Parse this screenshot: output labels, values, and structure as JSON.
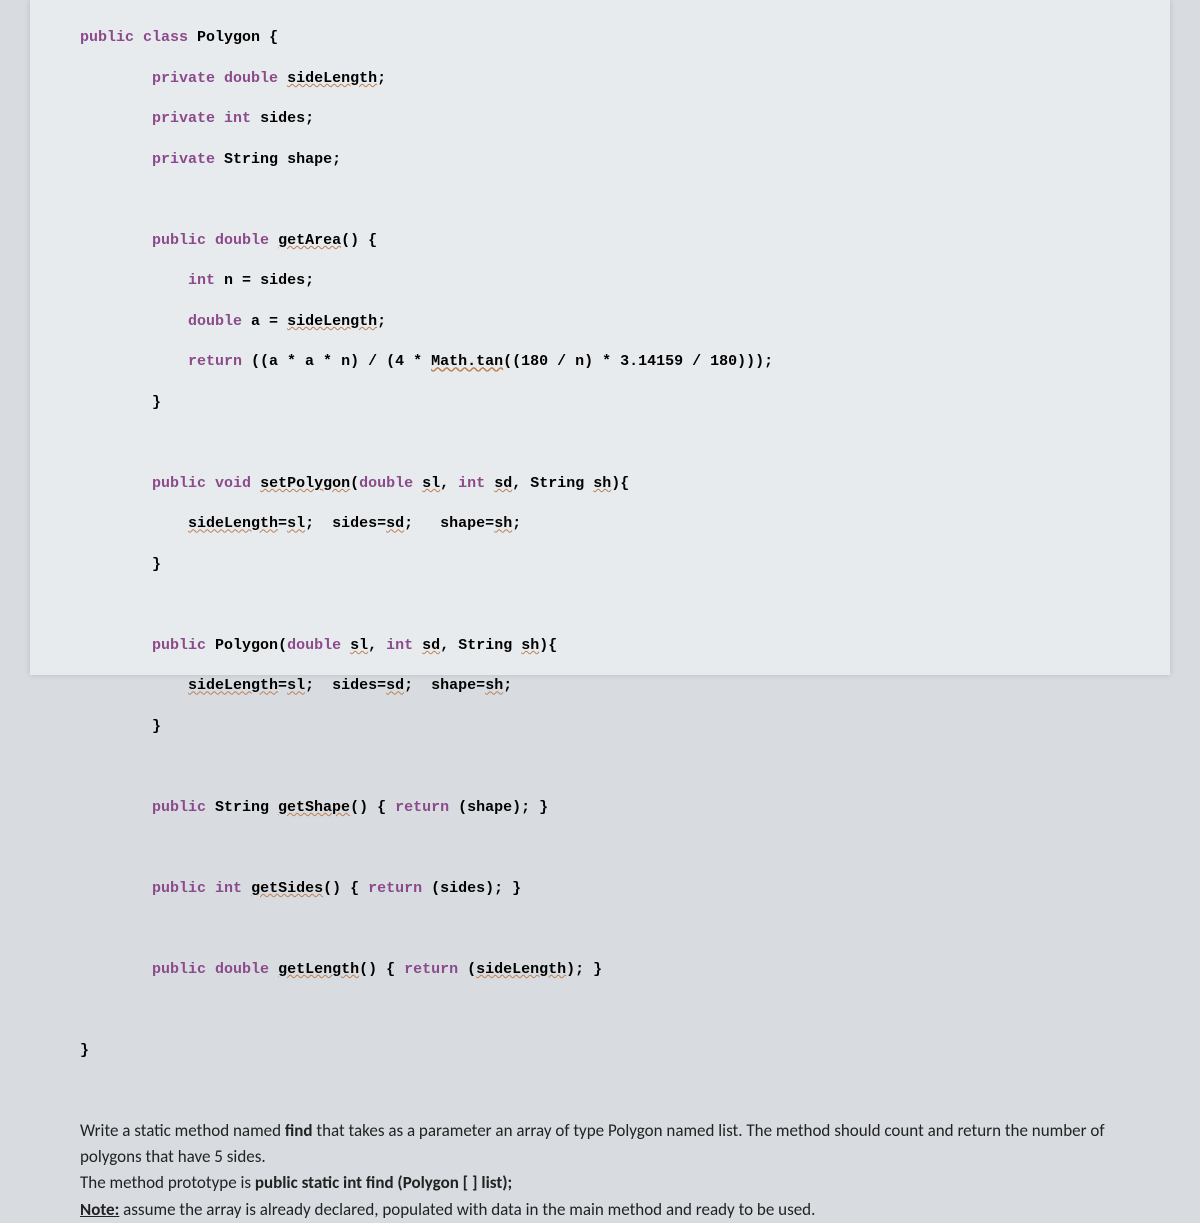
{
  "code": {
    "l1": "public class Polygon {",
    "l2": "        private double sideLength;",
    "l3": "        private int sides;",
    "l4": "        private String shape;",
    "l5": "",
    "l6": "        public double getArea() {",
    "l7": "            int n = sides;",
    "l8": "            double a = sideLength;",
    "l9": "            return ((a * a * n) / (4 * Math.tan((180 / n) * 3.14159 / 180)));",
    "l10": "        }",
    "l11": "",
    "l12": "        public void setPolygon(double sl, int sd, String sh){",
    "l13": "            sideLength=sl;  sides=sd;   shape=sh;",
    "l14": "        }",
    "l15": "",
    "l16": "        public Polygon(double sl, int sd, String sh){",
    "l17": "            sideLength=sl;  sides=sd;  shape=sh;",
    "l18": "        }",
    "l19": "",
    "l20": "        public String getShape() { return (shape); }",
    "l21": "",
    "l22": "        public int getSides() { return (sides); }",
    "l23": "",
    "l24": "        public double getLength() { return (sideLength); }",
    "l25": "",
    "l26": "}"
  },
  "prose": {
    "p1a": "Write a static method named ",
    "p1b": "find",
    "p1c": " that takes as a parameter an array of type Polygon named list. The method should count and return the number of polygons that have 5 sides.",
    "p2a": "The method prototype is ",
    "p2b": "public static int find (Polygon [ ] list);",
    "note_label": "Note:",
    "note_text": " assume the array is already declared, populated with data in the main method and ready to be used."
  }
}
